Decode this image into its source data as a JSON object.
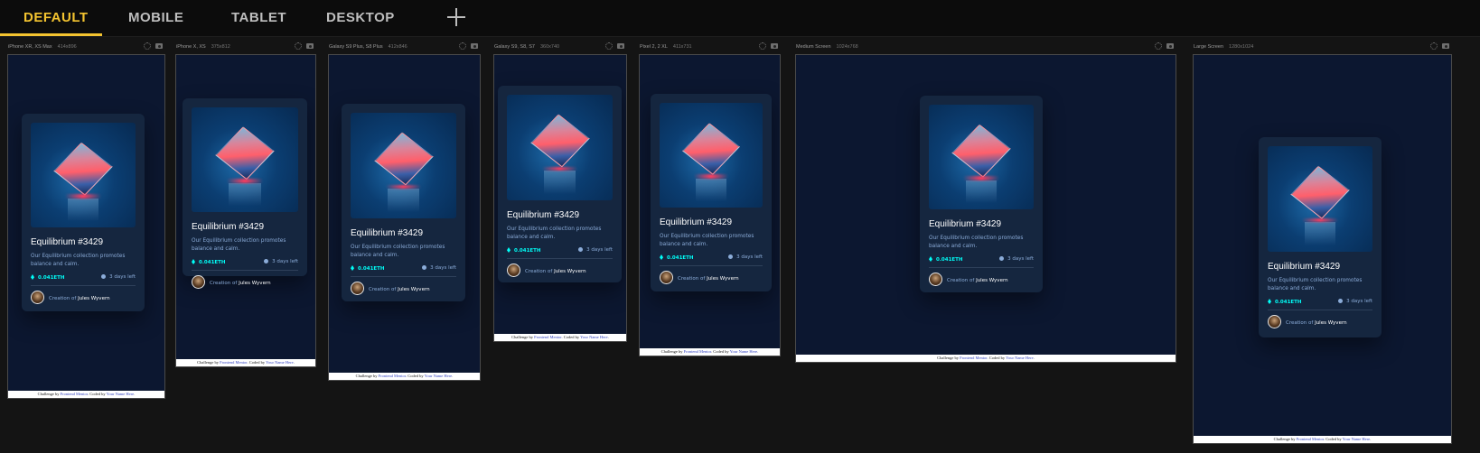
{
  "tabs": [
    "DEFAULT",
    "MOBILE",
    "TABLET",
    "DESKTOP"
  ],
  "active_tab": "DEFAULT",
  "devices": [
    {
      "name": "iPhone XR, XS Max",
      "size": "414x896"
    },
    {
      "name": "iPhone X, XS",
      "size": "375x812"
    },
    {
      "name": "Galaxy S9 Plus, S8 Plus",
      "size": "412x846"
    },
    {
      "name": "Galaxy S9, S8, S7",
      "size": "360x740"
    },
    {
      "name": "Pixel 2, 2 XL",
      "size": "411x731"
    },
    {
      "name": "Medium Screen",
      "size": "1024x768"
    },
    {
      "name": "Large Screen",
      "size": "1280x1024"
    }
  ],
  "card": {
    "title": "Equilibrium #3429",
    "description": "Our Equilibrium collection promotes balance and calm.",
    "price": "0.041ETH",
    "time_left": "3 days left",
    "creation_prefix": "Creation of",
    "creator": "Jules Wyvern"
  },
  "attribution": {
    "challenge_prefix": "Challenge by",
    "challenge_link": "Frontend Mentor",
    "coded_prefix": ". Coded by",
    "coder_link": "Your Name Here",
    "suffix": "."
  },
  "colors": {
    "accent": "#f4c430",
    "card_bg": "#15263f",
    "page_bg": "#0c1730",
    "cyan": "#00fff8",
    "soft_blue": "#8bacd9"
  }
}
